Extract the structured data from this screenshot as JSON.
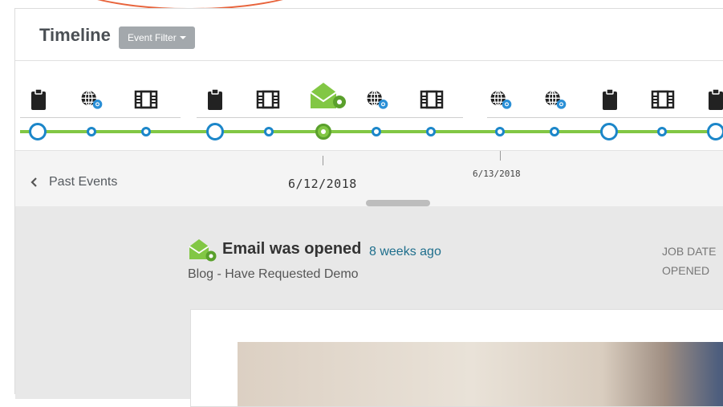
{
  "header": {
    "title": "Timeline",
    "filter_label": "Event Filter"
  },
  "timeline": {
    "icons": [
      "clipboard-icon",
      "globe-chrome-icon",
      "film-icon",
      "clipboard-icon",
      "film-icon",
      "email-open-icon",
      "globe-chrome-icon",
      "film-icon",
      "globe-chrome-icon",
      "globe-chrome-icon",
      "clipboard-icon",
      "film-icon",
      "clipboard-icon"
    ],
    "active_event": "email-open-icon"
  },
  "date_bar": {
    "past_events_label": "Past Events",
    "date_primary": "6/12/2018",
    "date_secondary": "6/13/2018"
  },
  "event": {
    "title": "Email was opened",
    "time_ago": "8 weeks ago",
    "subtitle": "Blog - Have Requested Demo",
    "meta_line1": "JOB DATE",
    "meta_line2": "OPENED"
  },
  "colors": {
    "accent_green": "#82c744",
    "node_blue": "#1b86c9",
    "chrome_blue": "#2a8fd6",
    "link_teal": "#1e6e8c",
    "orange_arc": "#e8643c"
  }
}
